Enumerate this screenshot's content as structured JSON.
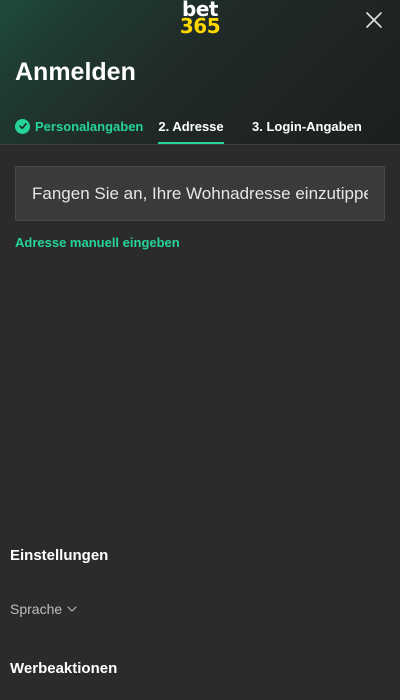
{
  "brand": {
    "logo_top": "bet",
    "logo_bottom": "365",
    "logo_top_color": "#ffffff",
    "logo_bottom_color": "#ffd700"
  },
  "header": {
    "title": "Anmelden",
    "close_icon": "close-icon"
  },
  "steps": [
    {
      "label": "Personalangaben",
      "state": "completed",
      "icon": "check-circle-icon"
    },
    {
      "label": "2. Adresse",
      "state": "active"
    },
    {
      "label": "3. Login-Angaben",
      "state": "upcoming"
    }
  ],
  "address": {
    "placeholder": "Fangen Sie an, Ihre Wohnadresse einzutippen",
    "value": "",
    "manual_link": "Adresse manuell eingeben"
  },
  "footer": {
    "settings_heading": "Einstellungen",
    "language_label": "Sprache",
    "language_icon": "chevron-down-icon",
    "promotions_heading": "Werbeaktionen"
  },
  "colors": {
    "accent": "#26d39a",
    "background": "#2b2b2b",
    "input_background": "#3a3a3a"
  }
}
